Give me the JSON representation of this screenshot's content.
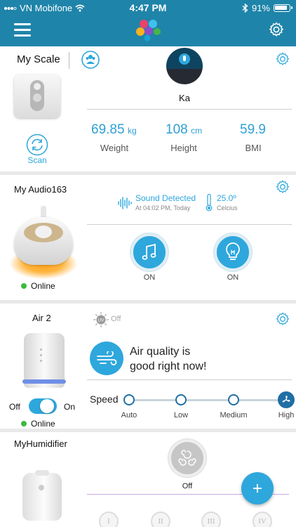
{
  "status_bar": {
    "carrier": "VN Mobifone",
    "time": "4:47 PM",
    "battery": "91%"
  },
  "scale": {
    "title": "My Scale",
    "user_name": "Ka",
    "scan_label": "Scan",
    "weight_value": "69.85",
    "weight_unit": "kg",
    "weight_label": "Weight",
    "height_value": "108",
    "height_unit": "cm",
    "height_label": "Height",
    "bmi_value": "59.9",
    "bmi_label": "BMI"
  },
  "audio": {
    "title": "My Audio163",
    "sound_status": "Sound Detected",
    "sound_time": "At 04:02 PM, Today",
    "temperature": "25.0º",
    "temperature_unit": "Celcius",
    "status": "Online",
    "music_state": "ON",
    "light_state": "ON"
  },
  "air": {
    "title": "Air 2",
    "uv_label": "Off",
    "quality_line1": "Air quality is",
    "quality_line2": "good right now!",
    "speed_label": "Speed",
    "speeds": [
      "Auto",
      "Low",
      "Medium",
      "High"
    ],
    "selected_speed": "High",
    "toggle_off": "Off",
    "toggle_on": "On",
    "status": "Online"
  },
  "humidifier": {
    "title": "MyHumidifier",
    "state": "Off",
    "levels": [
      "I",
      "II",
      "III",
      "IV"
    ]
  },
  "colors": {
    "header": "#1f84a9",
    "accent": "#2ea7dd",
    "online": "#3cba3c",
    "uv_badge": "#f5f5f5"
  }
}
